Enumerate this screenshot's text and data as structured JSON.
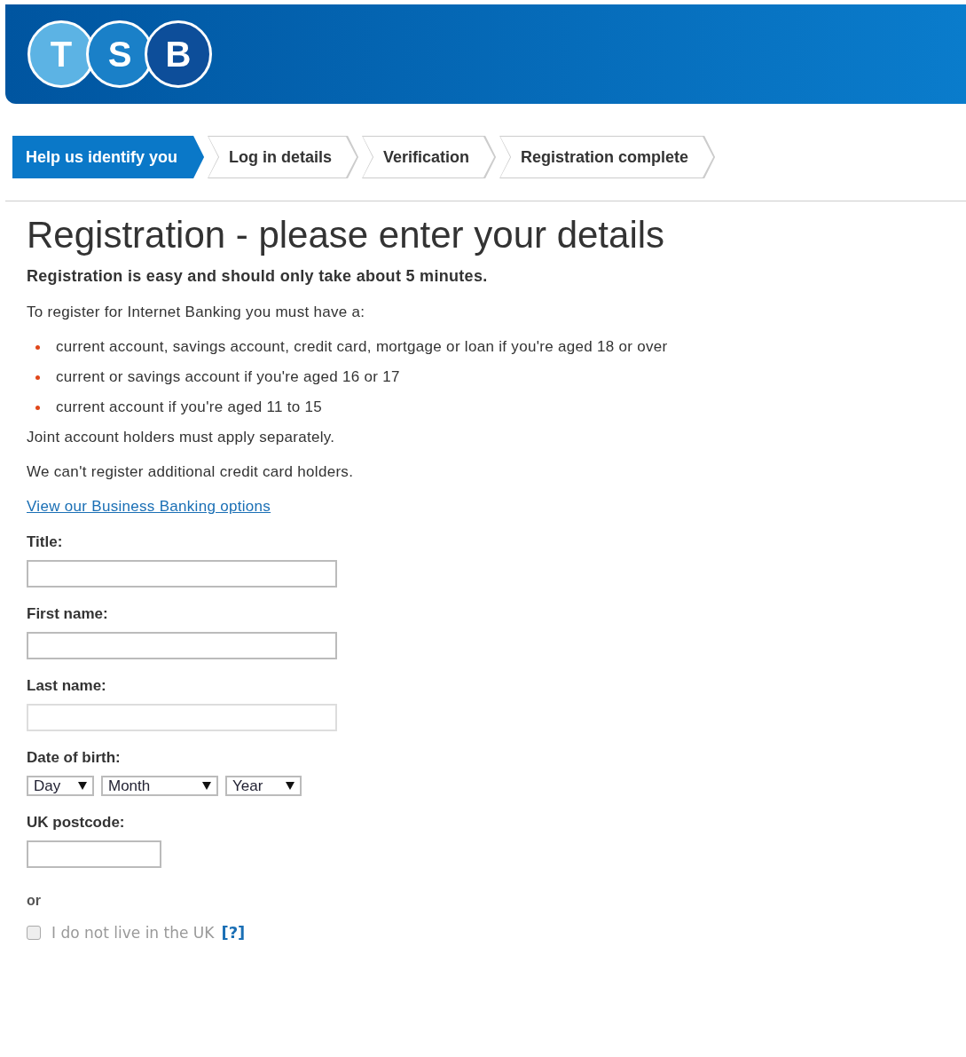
{
  "logo": {
    "letters": [
      "T",
      "S",
      "B"
    ]
  },
  "steps": [
    {
      "label": "Help us identify you",
      "selected": true
    },
    {
      "label": "Log in details",
      "selected": false
    },
    {
      "label": "Verification",
      "selected": false
    },
    {
      "label": "Registration complete",
      "selected": false
    }
  ],
  "heading": "Registration - please enter your details",
  "intro": "Registration is easy and should only take about 5 minutes.",
  "requirements_lead": "To register for Internet Banking you must have a:",
  "requirements": [
    "current account, savings account, credit card, mortgage or loan if you're aged 18 or over",
    "current or savings account if you're aged 16 or 17",
    "current account if you're aged 11 to 15"
  ],
  "notes": [
    "Joint account holders must apply separately.",
    "We can't register additional credit card holders."
  ],
  "business_link": "View our Business Banking options",
  "fields": [
    {
      "kind": "text",
      "label": "Title:",
      "disabled": false
    },
    {
      "kind": "text",
      "label": "First name:",
      "disabled": false
    },
    {
      "kind": "text",
      "label": "Last name:",
      "disabled": true
    },
    {
      "kind": "date",
      "label": "Date of birth:",
      "selects": [
        "Day",
        "Month",
        "Year"
      ]
    },
    {
      "kind": "short",
      "label": "UK postcode:"
    }
  ],
  "or_text": "or",
  "not_uk": {
    "label": "I do not live in the UK",
    "checked": false,
    "help": "[?]"
  }
}
